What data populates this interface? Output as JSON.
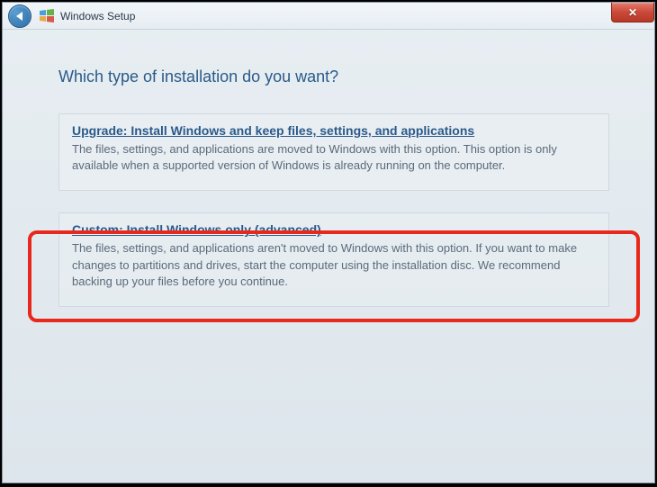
{
  "window": {
    "title": "Windows Setup"
  },
  "heading": "Which type of installation do you want?",
  "options": {
    "upgrade": {
      "title": "Upgrade: Install Windows and keep files, settings, and applications",
      "description": "The files, settings, and applications are moved to Windows with this option. This option is only available when a supported version of Windows is already running on the computer."
    },
    "custom": {
      "title": "Custom: Install Windows only (advanced)",
      "description": "The files, settings, and applications aren't moved to Windows with this option. If you want to make changes to partitions and drives, start the computer using the installation disc. We recommend backing up your files before you continue."
    }
  }
}
